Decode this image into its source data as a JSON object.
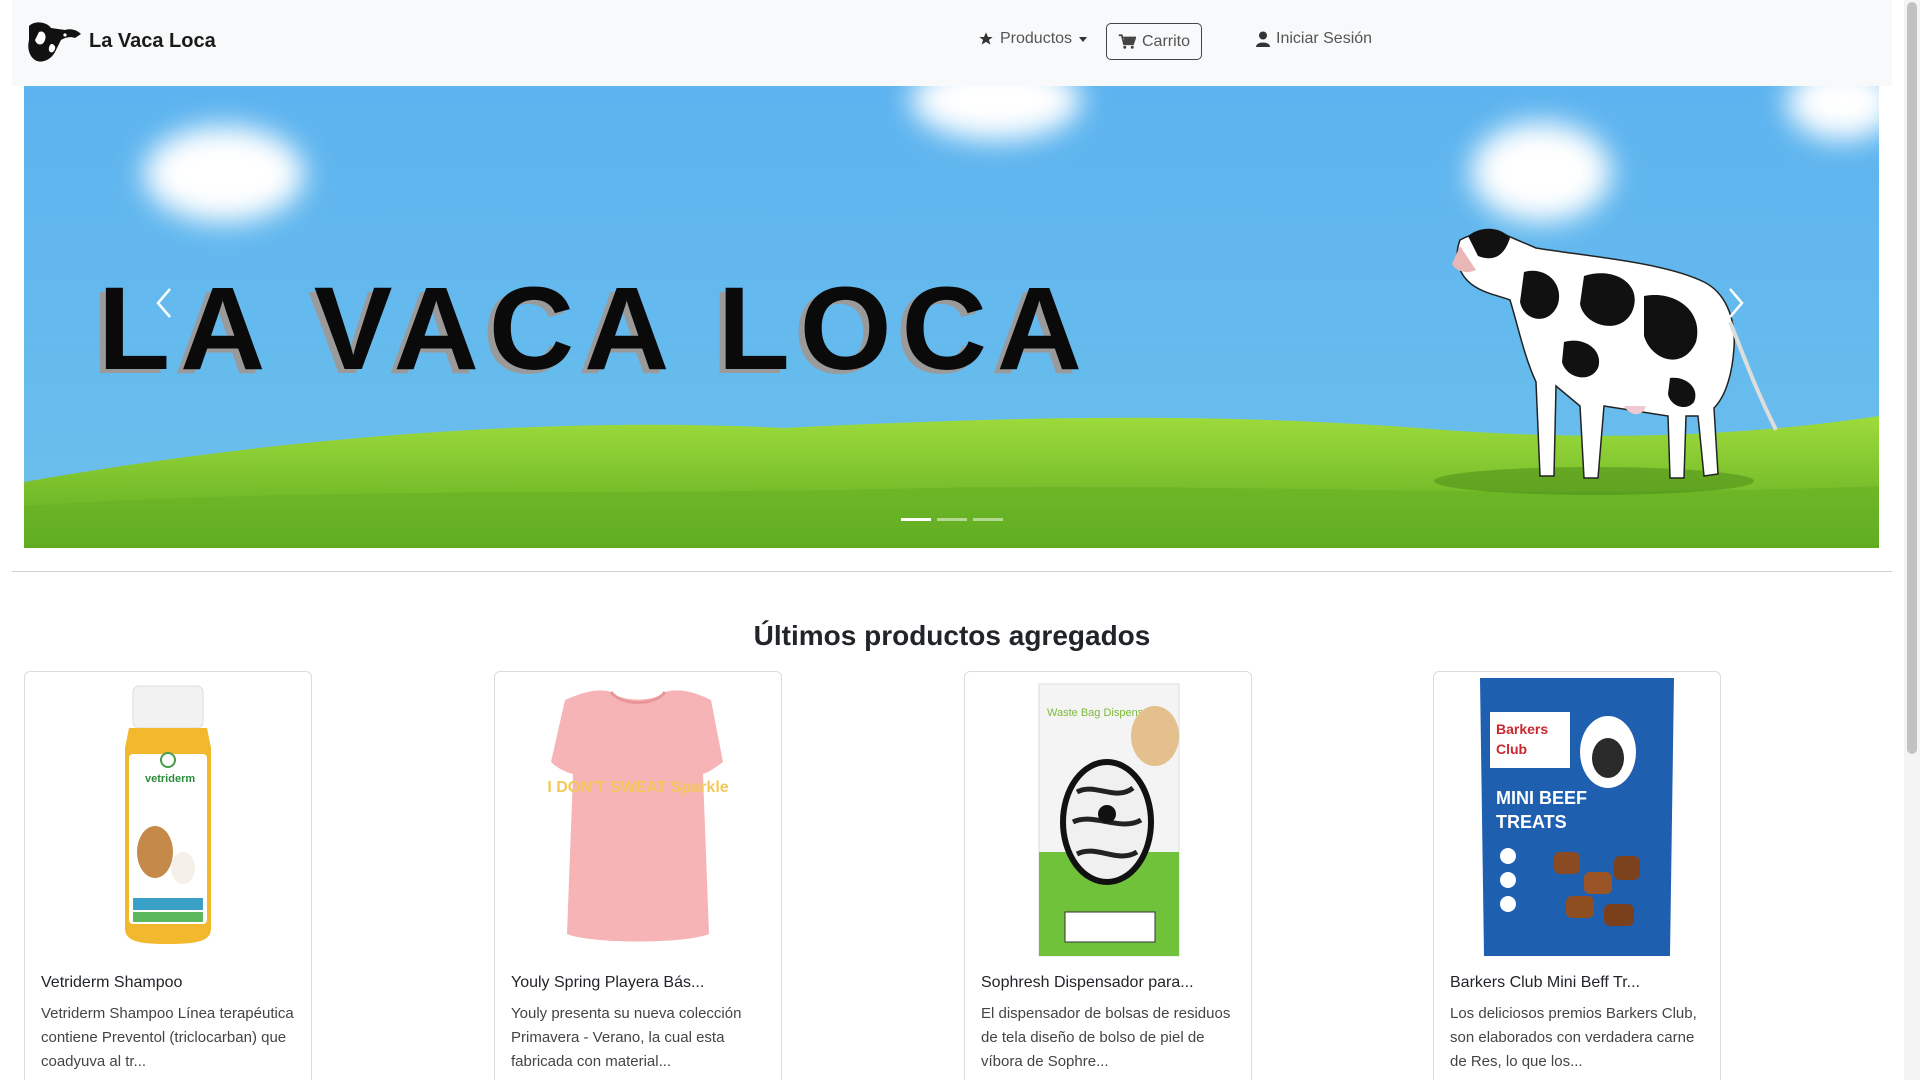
{
  "navbar": {
    "brand": "La Vaca Loca",
    "products_label": "Productos",
    "cart_label": "Carrito",
    "login_label": "Iniciar Sesión"
  },
  "carousel": {
    "banner_text": "LA VACA LOCA",
    "slide_count": 3,
    "active_slide": 1,
    "colors": {
      "sky": "#62b4ec",
      "grass": "#7cc52a"
    }
  },
  "section": {
    "title": "Últimos productos agregados"
  },
  "products": [
    {
      "name": "Vetriderm Shampoo",
      "description": "Vetriderm Shampoo Línea terapéutica contiene Preventol (triclocarban) que coadyuva al tr...",
      "image_label": "vetriderm"
    },
    {
      "name": "Youly Spring Playera Bás...",
      "description": "Youly presenta su nueva colección Primavera - Verano, la cual esta fabricada con material...",
      "image_label": "I DON'T SWEAT Sparkle"
    },
    {
      "name": "Sophresh Dispensador para...",
      "description": "El dispensador de bolsas de residuos de tela diseño de bolso de piel de víbora de Sophre...",
      "image_label": "Waste Bag Dispenser"
    },
    {
      "name": "Barkers Club Mini Beff Tr...",
      "description": "Los deliciosos premios Barkers Club, son elaborados con verdadera carne de Res, lo que los...",
      "image_label": "Barkers Club MINI BEEF TREATS"
    }
  ]
}
